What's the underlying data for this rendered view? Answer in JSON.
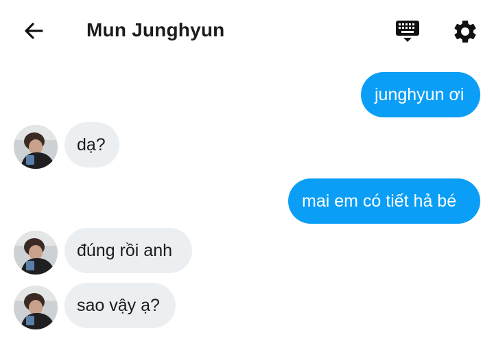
{
  "header": {
    "title": "Mun Junghyun",
    "back_icon": "arrow-left-icon",
    "keyboard_icon": "keyboard-icon",
    "settings_icon": "gear-icon"
  },
  "colors": {
    "outgoing_bubble": "#0a9ef6",
    "incoming_bubble": "#eceff2",
    "text_dark": "#1c1c1c",
    "icon": "#111111"
  },
  "messages": [
    {
      "direction": "out",
      "text": "junghyun ơi"
    },
    {
      "direction": "in",
      "text": "dạ?"
    },
    {
      "direction": "out",
      "text": "mai em có tiết hả bé"
    },
    {
      "direction": "in",
      "text": "đúng rồi anh"
    },
    {
      "direction": "in",
      "text": "sao vậy ạ?"
    }
  ]
}
